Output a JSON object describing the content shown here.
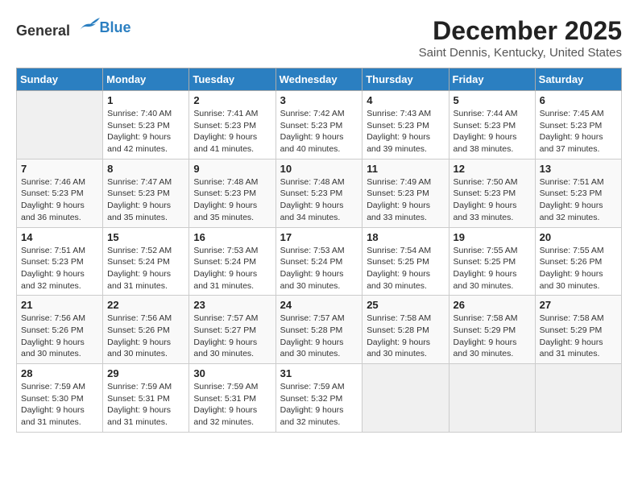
{
  "header": {
    "logo_general": "General",
    "logo_blue": "Blue",
    "title": "December 2025",
    "location": "Saint Dennis, Kentucky, United States"
  },
  "days_of_week": [
    "Sunday",
    "Monday",
    "Tuesday",
    "Wednesday",
    "Thursday",
    "Friday",
    "Saturday"
  ],
  "weeks": [
    [
      {
        "day": "",
        "sunrise": "",
        "sunset": "",
        "daylight": ""
      },
      {
        "day": "1",
        "sunrise": "7:40 AM",
        "sunset": "5:23 PM",
        "daylight": "9 hours and 42 minutes."
      },
      {
        "day": "2",
        "sunrise": "7:41 AM",
        "sunset": "5:23 PM",
        "daylight": "9 hours and 41 minutes."
      },
      {
        "day": "3",
        "sunrise": "7:42 AM",
        "sunset": "5:23 PM",
        "daylight": "9 hours and 40 minutes."
      },
      {
        "day": "4",
        "sunrise": "7:43 AM",
        "sunset": "5:23 PM",
        "daylight": "9 hours and 39 minutes."
      },
      {
        "day": "5",
        "sunrise": "7:44 AM",
        "sunset": "5:23 PM",
        "daylight": "9 hours and 38 minutes."
      },
      {
        "day": "6",
        "sunrise": "7:45 AM",
        "sunset": "5:23 PM",
        "daylight": "9 hours and 37 minutes."
      }
    ],
    [
      {
        "day": "7",
        "sunrise": "7:46 AM",
        "sunset": "5:23 PM",
        "daylight": "9 hours and 36 minutes."
      },
      {
        "day": "8",
        "sunrise": "7:47 AM",
        "sunset": "5:23 PM",
        "daylight": "9 hours and 35 minutes."
      },
      {
        "day": "9",
        "sunrise": "7:48 AM",
        "sunset": "5:23 PM",
        "daylight": "9 hours and 35 minutes."
      },
      {
        "day": "10",
        "sunrise": "7:48 AM",
        "sunset": "5:23 PM",
        "daylight": "9 hours and 34 minutes."
      },
      {
        "day": "11",
        "sunrise": "7:49 AM",
        "sunset": "5:23 PM",
        "daylight": "9 hours and 33 minutes."
      },
      {
        "day": "12",
        "sunrise": "7:50 AM",
        "sunset": "5:23 PM",
        "daylight": "9 hours and 33 minutes."
      },
      {
        "day": "13",
        "sunrise": "7:51 AM",
        "sunset": "5:23 PM",
        "daylight": "9 hours and 32 minutes."
      }
    ],
    [
      {
        "day": "14",
        "sunrise": "7:51 AM",
        "sunset": "5:23 PM",
        "daylight": "9 hours and 32 minutes."
      },
      {
        "day": "15",
        "sunrise": "7:52 AM",
        "sunset": "5:24 PM",
        "daylight": "9 hours and 31 minutes."
      },
      {
        "day": "16",
        "sunrise": "7:53 AM",
        "sunset": "5:24 PM",
        "daylight": "9 hours and 31 minutes."
      },
      {
        "day": "17",
        "sunrise": "7:53 AM",
        "sunset": "5:24 PM",
        "daylight": "9 hours and 30 minutes."
      },
      {
        "day": "18",
        "sunrise": "7:54 AM",
        "sunset": "5:25 PM",
        "daylight": "9 hours and 30 minutes."
      },
      {
        "day": "19",
        "sunrise": "7:55 AM",
        "sunset": "5:25 PM",
        "daylight": "9 hours and 30 minutes."
      },
      {
        "day": "20",
        "sunrise": "7:55 AM",
        "sunset": "5:26 PM",
        "daylight": "9 hours and 30 minutes."
      }
    ],
    [
      {
        "day": "21",
        "sunrise": "7:56 AM",
        "sunset": "5:26 PM",
        "daylight": "9 hours and 30 minutes."
      },
      {
        "day": "22",
        "sunrise": "7:56 AM",
        "sunset": "5:26 PM",
        "daylight": "9 hours and 30 minutes."
      },
      {
        "day": "23",
        "sunrise": "7:57 AM",
        "sunset": "5:27 PM",
        "daylight": "9 hours and 30 minutes."
      },
      {
        "day": "24",
        "sunrise": "7:57 AM",
        "sunset": "5:28 PM",
        "daylight": "9 hours and 30 minutes."
      },
      {
        "day": "25",
        "sunrise": "7:58 AM",
        "sunset": "5:28 PM",
        "daylight": "9 hours and 30 minutes."
      },
      {
        "day": "26",
        "sunrise": "7:58 AM",
        "sunset": "5:29 PM",
        "daylight": "9 hours and 30 minutes."
      },
      {
        "day": "27",
        "sunrise": "7:58 AM",
        "sunset": "5:29 PM",
        "daylight": "9 hours and 31 minutes."
      }
    ],
    [
      {
        "day": "28",
        "sunrise": "7:59 AM",
        "sunset": "5:30 PM",
        "daylight": "9 hours and 31 minutes."
      },
      {
        "day": "29",
        "sunrise": "7:59 AM",
        "sunset": "5:31 PM",
        "daylight": "9 hours and 31 minutes."
      },
      {
        "day": "30",
        "sunrise": "7:59 AM",
        "sunset": "5:31 PM",
        "daylight": "9 hours and 32 minutes."
      },
      {
        "day": "31",
        "sunrise": "7:59 AM",
        "sunset": "5:32 PM",
        "daylight": "9 hours and 32 minutes."
      },
      {
        "day": "",
        "sunrise": "",
        "sunset": "",
        "daylight": ""
      },
      {
        "day": "",
        "sunrise": "",
        "sunset": "",
        "daylight": ""
      },
      {
        "day": "",
        "sunrise": "",
        "sunset": "",
        "daylight": ""
      }
    ]
  ]
}
